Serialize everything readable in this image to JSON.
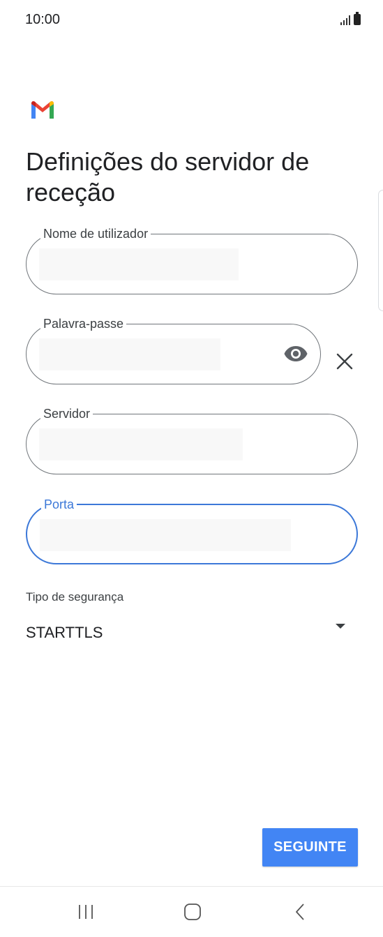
{
  "status_bar": {
    "time": "10:00",
    "signal_icon": "signal-icon",
    "battery_icon": "battery-icon"
  },
  "app": {
    "logo_icon": "gmail-logo-icon",
    "brand_colors": [
      "#ea4335",
      "#4285f4",
      "#34a853",
      "#fbbc04",
      "#c5221f"
    ]
  },
  "title": "Definições do servidor de receção",
  "form": {
    "username": {
      "label": "Nome de utilizador",
      "value": ""
    },
    "password": {
      "label": "Palavra-passe",
      "value": "",
      "reveal_icon": "eye-icon",
      "clear_icon": "close-icon"
    },
    "server": {
      "label": "Servidor",
      "value": ""
    },
    "port": {
      "label": "Porta",
      "value": "",
      "focused": true
    },
    "security": {
      "label": "Tipo de segurança",
      "selected": "STARTTLS",
      "arrow_icon": "dropdown-arrow-icon"
    }
  },
  "actions": {
    "next_label": "SEGUINTE"
  },
  "nav_bar": {
    "recents_icon": "recents-icon",
    "home_icon": "home-icon",
    "back_icon": "back-icon"
  },
  "colors": {
    "accent": "#4285f4",
    "focus_border": "#3c78d8",
    "field_border": "#70757a"
  }
}
